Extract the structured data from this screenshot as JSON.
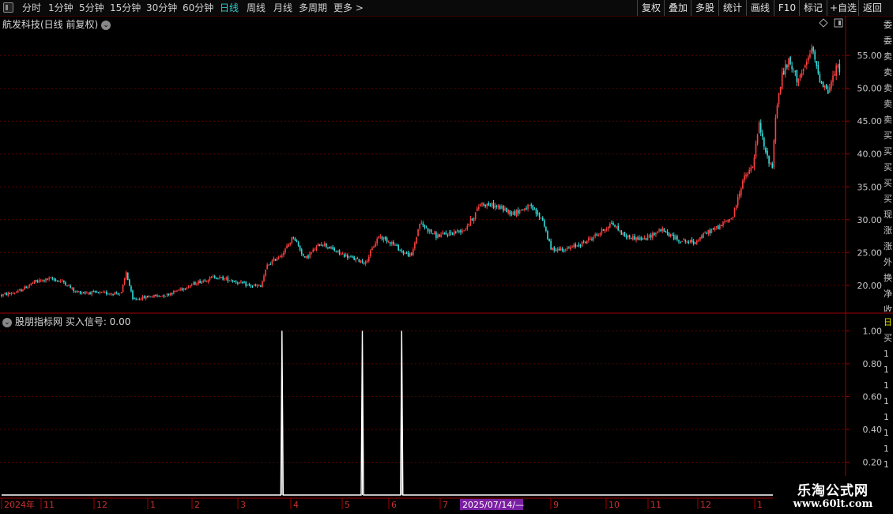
{
  "toolbar": {
    "periods": [
      "分时",
      "1分钟",
      "5分钟",
      "15分钟",
      "30分钟",
      "60分钟",
      "日线",
      "周线",
      "月线",
      "多周期",
      "更多 >"
    ],
    "active_period": "日线",
    "right_buttons": [
      "复权",
      "叠加",
      "多股",
      "统计",
      "画线",
      "F10",
      "标记",
      "+自选",
      "返回"
    ]
  },
  "main_panel": {
    "title": "航发科技(日线 前复权)"
  },
  "indicator_panel": {
    "title": "股朋指标网 买入信号: 0.00"
  },
  "side_strip_main": [
    "委",
    "委",
    "卖",
    "卖",
    "卖",
    "卖",
    "卖",
    "买",
    "买",
    "买",
    "买",
    "买",
    "现",
    "涨",
    "涨",
    "外",
    "换",
    "净",
    "收"
  ],
  "side_strip_ind": [
    "日",
    "买",
    "1",
    "1",
    "1",
    "1",
    "1",
    "1",
    "1",
    "1"
  ],
  "date_axis": {
    "labels": [
      "2024年",
      "11",
      "12",
      "1",
      "2",
      "3",
      "4",
      "5",
      "6",
      "7",
      "9",
      "10",
      "11",
      "12",
      "1"
    ],
    "highlight": "2025/07/14/—"
  },
  "watermark": {
    "line1": "乐淘公式网",
    "line2": "www.60lt.com"
  },
  "colors": {
    "up": "#ff4040",
    "down": "#33dddd",
    "grid": "#5a0000",
    "axis": "#a00000",
    "active": "#33cccc",
    "signal": "#ffffff",
    "highlight_bg": "#7a1fa2"
  },
  "chart_data": [
    {
      "type": "candlestick",
      "title": "航发科技(日线 前复权)",
      "ylim": [
        16,
        59
      ],
      "y_ticks": [
        "20.00",
        "25.00",
        "30.00",
        "35.00",
        "40.00",
        "45.00",
        "50.00",
        "55.00"
      ],
      "keypoints": [
        [
          0,
          18.5
        ],
        [
          10,
          19.0
        ],
        [
          20,
          20.5
        ],
        [
          30,
          21.0
        ],
        [
          38,
          20.5
        ],
        [
          45,
          19.0
        ],
        [
          60,
          18.8
        ],
        [
          73,
          18.8
        ],
        [
          76,
          22.0
        ],
        [
          80,
          17.8
        ],
        [
          90,
          18.3
        ],
        [
          100,
          18.5
        ],
        [
          110,
          19.5
        ],
        [
          120,
          20.5
        ],
        [
          130,
          21.3
        ],
        [
          140,
          20.8
        ],
        [
          150,
          20.0
        ],
        [
          158,
          19.8
        ],
        [
          162,
          23.0
        ],
        [
          172,
          25.0
        ],
        [
          178,
          27.5
        ],
        [
          185,
          24.0
        ],
        [
          195,
          26.5
        ],
        [
          205,
          25.0
        ],
        [
          215,
          24.0
        ],
        [
          222,
          23.5
        ],
        [
          230,
          27.5
        ],
        [
          238,
          26.5
        ],
        [
          245,
          25.0
        ],
        [
          250,
          24.5
        ],
        [
          255,
          29.5
        ],
        [
          265,
          27.5
        ],
        [
          275,
          28.0
        ],
        [
          282,
          28.5
        ],
        [
          288,
          30.5
        ],
        [
          292,
          32.5
        ],
        [
          302,
          32.0
        ],
        [
          312,
          31.0
        ],
        [
          322,
          32.0
        ],
        [
          330,
          30.0
        ],
        [
          335,
          25.5
        ],
        [
          345,
          25.5
        ],
        [
          355,
          26.5
        ],
        [
          365,
          28.0
        ],
        [
          372,
          29.5
        ],
        [
          380,
          27.5
        ],
        [
          392,
          27.0
        ],
        [
          402,
          28.5
        ],
        [
          412,
          27.0
        ],
        [
          422,
          26.5
        ],
        [
          430,
          28.0
        ],
        [
          438,
          29.0
        ],
        [
          446,
          30.5
        ],
        [
          452,
          36.0
        ],
        [
          458,
          38.0
        ],
        [
          462,
          44.5
        ],
        [
          466,
          40.0
        ],
        [
          470,
          38.0
        ],
        [
          472,
          46.0
        ],
        [
          476,
          52.0
        ],
        [
          480,
          54.0
        ],
        [
          485,
          51.5
        ],
        [
          490,
          53.0
        ],
        [
          494,
          56.0
        ],
        [
          499,
          51.5
        ],
        [
          504,
          49.5
        ],
        [
          509,
          53.0
        ]
      ]
    },
    {
      "type": "line",
      "title": "股朋指标网 买入信号",
      "ylim": [
        0,
        1.05
      ],
      "y_ticks": [
        "0.20",
        "0.40",
        "0.60",
        "0.80",
        "1.00"
      ],
      "values_description": "signal is 0 except spikes to 1 on days 171, 220, 244",
      "spikes_x": [
        171,
        220,
        244
      ],
      "spike_value": 1.0,
      "baseline_value": 0.0,
      "last_value": "0.00"
    }
  ]
}
